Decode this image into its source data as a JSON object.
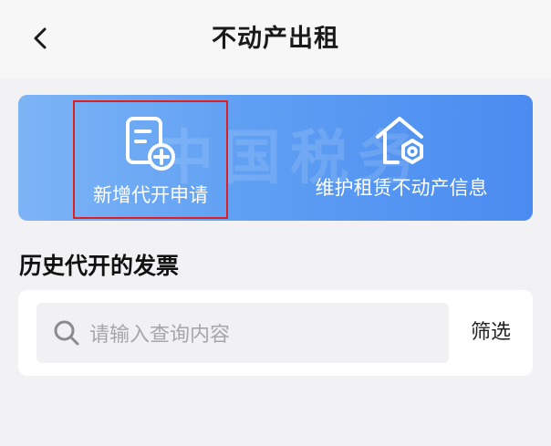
{
  "header": {
    "title": "不动产出租",
    "back_icon": "chevron-left-icon"
  },
  "banner": {
    "watermark": "中国税务",
    "actions": [
      {
        "label": "新增代开申请",
        "icon": "document-add-icon"
      },
      {
        "label": "维护租赁不动产信息",
        "icon": "house-gear-icon"
      }
    ]
  },
  "history": {
    "title": "历史代开的发票"
  },
  "search": {
    "placeholder": "请输入查询内容",
    "icon": "search-icon",
    "filter_label": "筛选"
  },
  "colors": {
    "banner_start": "#7db4f6",
    "banner_end": "#4a8bf0",
    "highlight_border": "#e02020"
  }
}
